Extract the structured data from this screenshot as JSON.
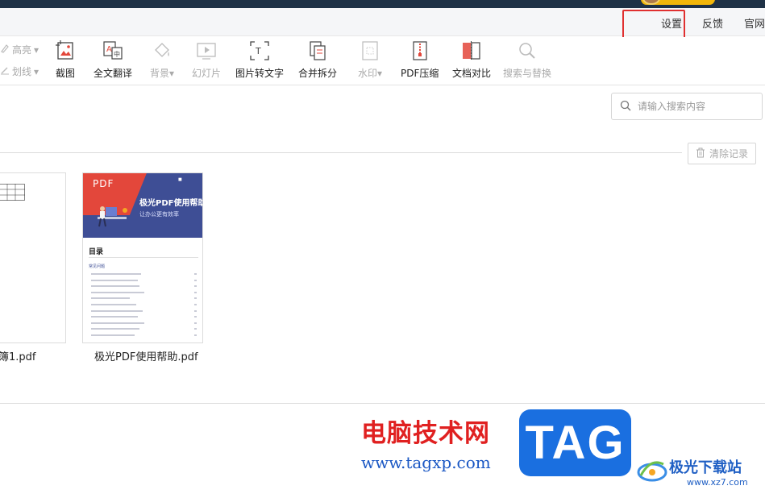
{
  "menubar": {
    "settings": "设置",
    "feedback": "反馈",
    "official_site": "官网"
  },
  "toolbar": {
    "highlight": "高亮",
    "strikethrough": "划线",
    "screenshot": "截图",
    "full_translate": "全文翻译",
    "background": "背景",
    "slideshow": "幻灯片",
    "image_to_text": "图片转文字",
    "merge_split": "合并拆分",
    "watermark": "水印",
    "pdf_compress": "PDF压缩",
    "doc_compare": "文档对比",
    "search_replace": "搜索与替换"
  },
  "search": {
    "placeholder": "请输入搜索内容"
  },
  "history": {
    "clear_label": "清除记录"
  },
  "files": [
    {
      "name": "簿1.pdf"
    },
    {
      "name": "极光PDF使用帮助.pdf",
      "thumb": {
        "badge": "PDF",
        "title": "极光PDF使用帮助",
        "subtitle": "让办公更有效率",
        "toc_title": "目录",
        "toc_section": "常见问题"
      }
    }
  ],
  "watermark": {
    "site_cn": "电脑技术网",
    "site_url": "www.tagxp.com",
    "tag": "TAG",
    "brand_cn": "极光下载站",
    "brand_url": "www.xz7.com"
  },
  "colors": {
    "topbar": "#1e3146",
    "highlight_box": "#e03030",
    "thumb_blue": "#3e4e95",
    "thumb_red": "#e3473b",
    "tag_blue": "#1a6fe0"
  }
}
